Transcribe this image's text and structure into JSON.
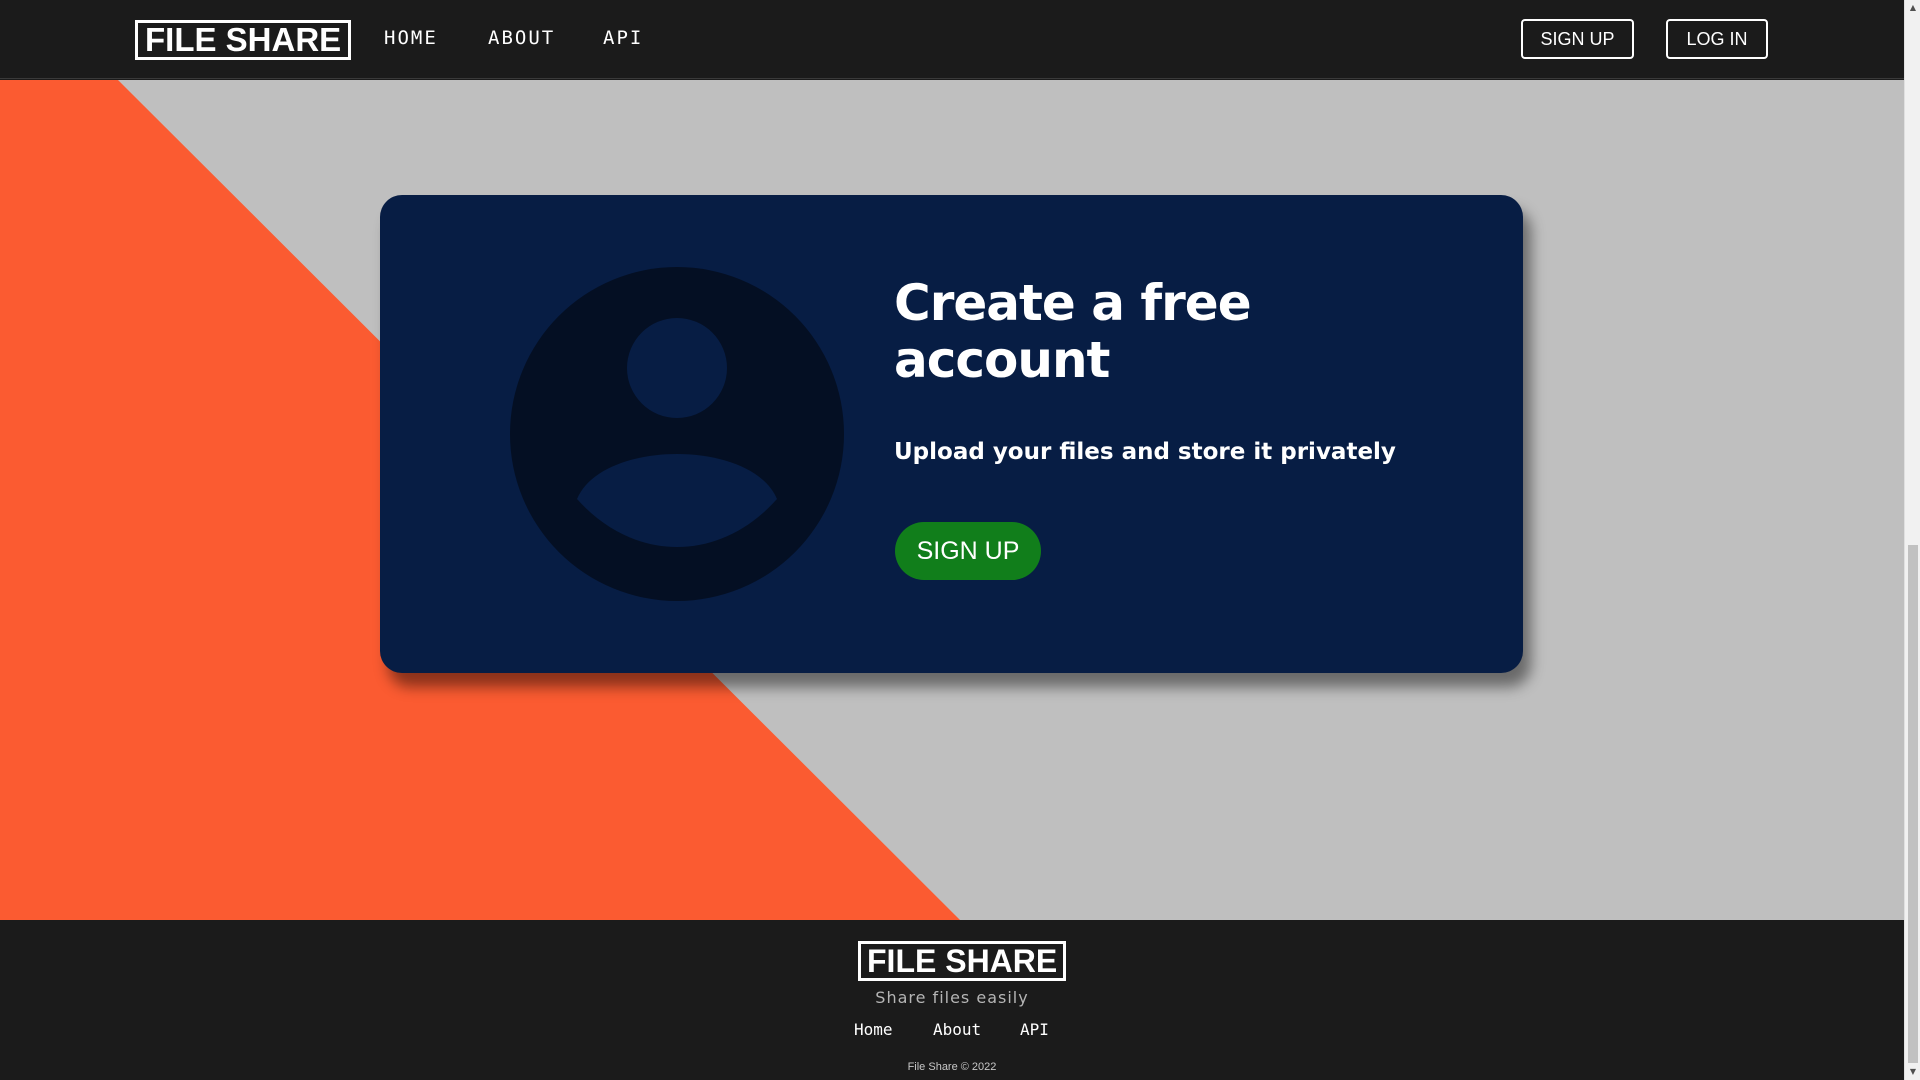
{
  "navbar": {
    "logo": "FILE SHARE",
    "links": [
      "HOME",
      "ABOUT",
      "API"
    ],
    "signup_label": "SIGN UP",
    "login_label": "LOG IN"
  },
  "hero": {
    "title": "Create a free account",
    "subtitle": "Upload your files and store it privately",
    "signup_label": "SIGN UP",
    "avatar_icon": "user-avatar-icon"
  },
  "footer": {
    "logo": "FILE SHARE",
    "tagline": "Share files easily",
    "links": [
      "Home",
      "About",
      "API"
    ],
    "copyright": "File Share © 2022"
  },
  "colors": {
    "nav_bg": "#1b1b1b",
    "hero_bg": "#bfbfbf",
    "accent_orange": "#fb5b31",
    "card_bg": "#071d44",
    "avatar_dark": "#040f23",
    "signup_green": "#117e1b"
  },
  "scrollbar": {
    "up_icon": "scroll-up-arrow-icon",
    "down_icon": "scroll-down-arrow-icon"
  }
}
